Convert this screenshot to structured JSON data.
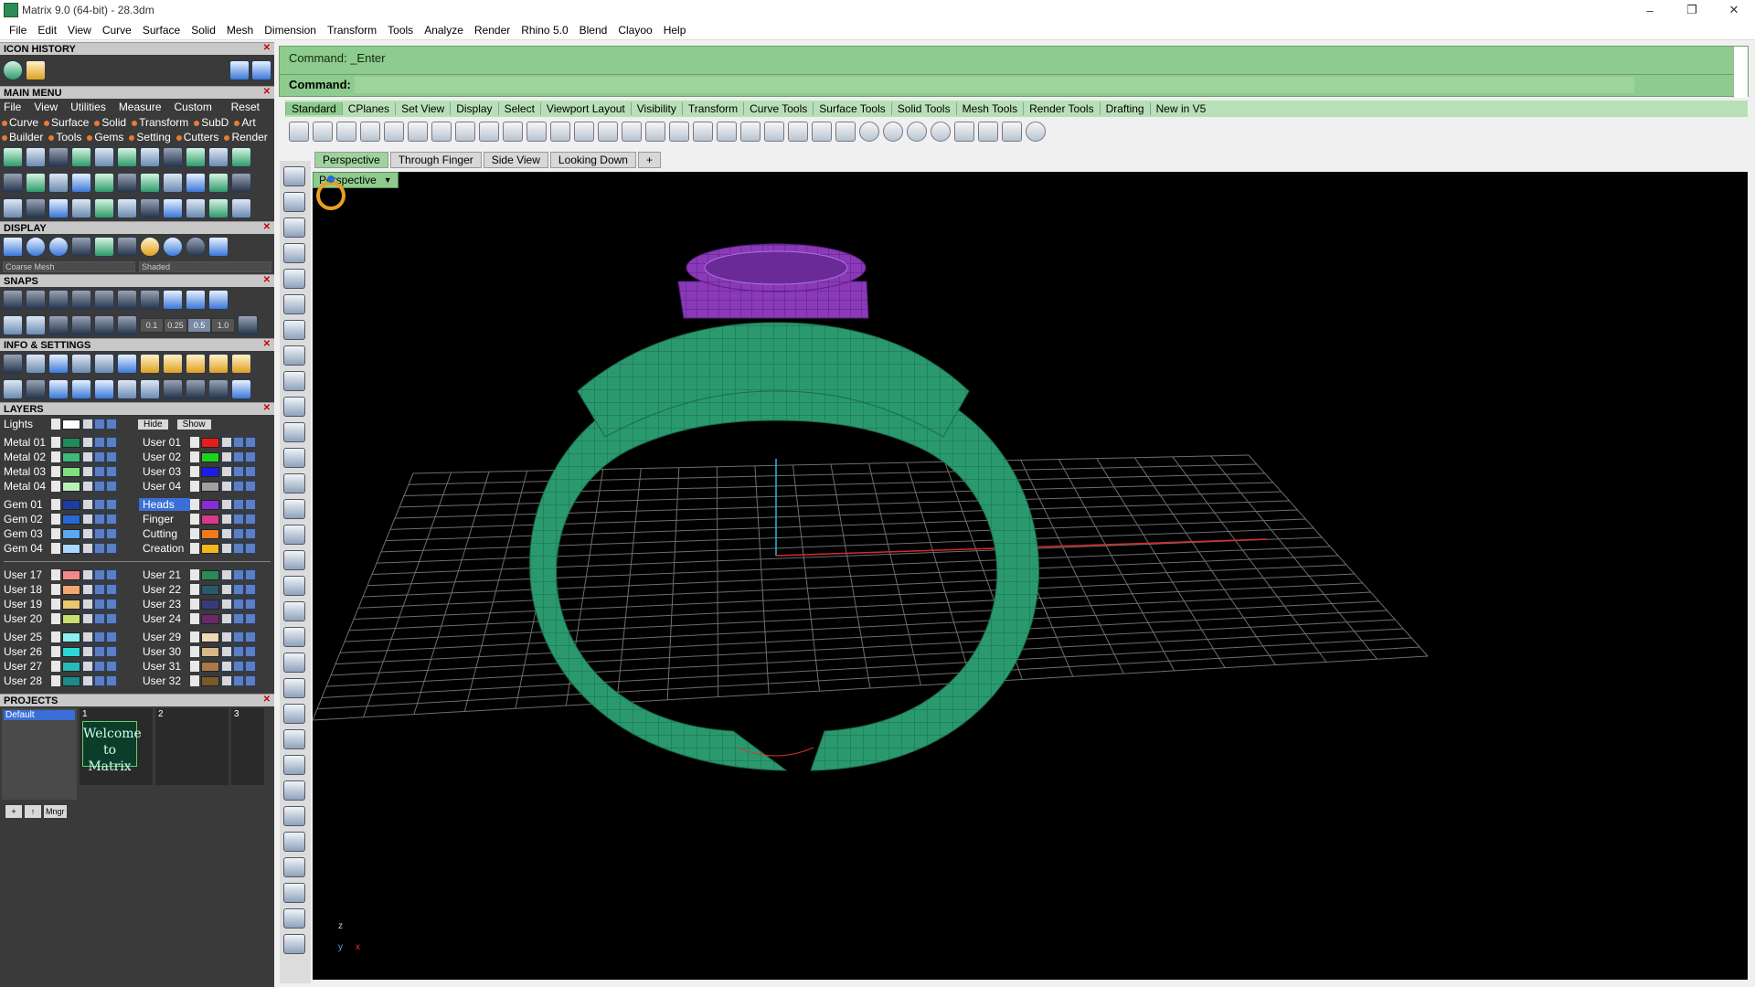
{
  "window": {
    "title": "Matrix 9.0 (64-bit) - 28.3dm",
    "min": "–",
    "max": "❐",
    "close": "✕"
  },
  "menubar": [
    "File",
    "Edit",
    "View",
    "Curve",
    "Surface",
    "Solid",
    "Mesh",
    "Dimension",
    "Transform",
    "Tools",
    "Analyze",
    "Render",
    "Rhino 5.0",
    "Blend",
    "Clayoo",
    "Help"
  ],
  "panels": {
    "icon_history": "ICON HISTORY",
    "main_menu": "MAIN MENU",
    "display": "DISPLAY",
    "snaps": "SNAPS",
    "info_settings": "INFO & SETTINGS",
    "layers": "LAYERS",
    "projects": "PROJECTS"
  },
  "main_menu": {
    "tabs": [
      "File",
      "View",
      "Utilities",
      "Measure",
      "Custom"
    ],
    "reset": "Reset",
    "row1": [
      "Curve",
      "Surface",
      "Solid",
      "Transform",
      "SubD",
      "Art"
    ],
    "row2": [
      "Builder",
      "Tools",
      "Gems",
      "Setting",
      "Cutters",
      "Render"
    ]
  },
  "display": {
    "mesh": "Coarse Mesh",
    "mode": "Shaded"
  },
  "snaps": {
    "values": [
      "0.1",
      "0.25",
      "0.5",
      "1.0"
    ],
    "selected": "0.5"
  },
  "layers": {
    "lights": "Lights",
    "hide": "Hide",
    "show": "Show",
    "groups": [
      {
        "left": [
          {
            "name": "Metal 01",
            "color": "#1f8a5a"
          },
          {
            "name": "Metal 02",
            "color": "#3fb97a"
          },
          {
            "name": "Metal 03",
            "color": "#7fe07f"
          },
          {
            "name": "Metal 04",
            "color": "#b8f0b8"
          }
        ],
        "right": [
          {
            "name": "User 01",
            "color": "#e81c1c"
          },
          {
            "name": "User 02",
            "color": "#1cd31c"
          },
          {
            "name": "User 03",
            "color": "#1c1ce8"
          },
          {
            "name": "User 04",
            "color": "#a0a0a0"
          }
        ]
      },
      {
        "left": [
          {
            "name": "Gem 01",
            "color": "#1a3fa0"
          },
          {
            "name": "Gem 02",
            "color": "#2a68d8"
          },
          {
            "name": "Gem 03",
            "color": "#5aa8f0"
          },
          {
            "name": "Gem 04",
            "color": "#a8d8ff"
          }
        ],
        "right": [
          {
            "name": "Heads",
            "color": "#8a2ad8",
            "highlight": true
          },
          {
            "name": "Finger",
            "color": "#d83a8a"
          },
          {
            "name": "Cutting",
            "color": "#f07a1a"
          },
          {
            "name": "Creation",
            "color": "#f0b81a"
          }
        ]
      },
      {
        "left": [
          {
            "name": "User 17",
            "color": "#f08a8a"
          },
          {
            "name": "User 18",
            "color": "#f0a870"
          },
          {
            "name": "User 19",
            "color": "#e8c870"
          },
          {
            "name": "User 20",
            "color": "#c8e070"
          }
        ],
        "right": [
          {
            "name": "User 21",
            "color": "#2a8a5a"
          },
          {
            "name": "User 22",
            "color": "#2a5a6a"
          },
          {
            "name": "User 23",
            "color": "#3a3a7a"
          },
          {
            "name": "User 24",
            "color": "#6a2a6a"
          }
        ]
      },
      {
        "left": [
          {
            "name": "User 25",
            "color": "#8af0f0"
          },
          {
            "name": "User 26",
            "color": "#2ad8d8"
          },
          {
            "name": "User 27",
            "color": "#2ab8b8"
          },
          {
            "name": "User 28",
            "color": "#1a8a8a"
          }
        ],
        "right": [
          {
            "name": "User 29",
            "color": "#f0d8b8"
          },
          {
            "name": "User 30",
            "color": "#d8b888"
          },
          {
            "name": "User 31",
            "color": "#a87a4a"
          },
          {
            "name": "User 32",
            "color": "#7a5a2a"
          }
        ]
      }
    ]
  },
  "projects": {
    "list": [
      "Default"
    ],
    "slots": [
      "1",
      "2",
      "3"
    ],
    "thumb_text": "Welcome to Matrix",
    "mgr": "Mngr"
  },
  "command": {
    "history": "Command: _Enter",
    "prompt": "Command:",
    "value": ""
  },
  "toolbar_tabs": [
    "Standard",
    "CPlanes",
    "Set View",
    "Display",
    "Select",
    "Viewport Layout",
    "Visibility",
    "Transform",
    "Curve Tools",
    "Surface Tools",
    "Solid Tools",
    "Mesh Tools",
    "Render Tools",
    "Drafting",
    "New in V5"
  ],
  "active_toolbar_tab": "Standard",
  "viewport_tabs": [
    "Perspective",
    "Through Finger",
    "Side View",
    "Looking Down"
  ],
  "active_viewport_tab": "Perspective",
  "viewport": {
    "label": "Perspective",
    "axis_z": "z",
    "axis_y": "y",
    "axis_x": "x"
  },
  "colors": {
    "ring": "#2a9a6e",
    "head": "#8a3ab8",
    "command_bg": "#8ecb8e",
    "grid": "#6e6e6e"
  }
}
